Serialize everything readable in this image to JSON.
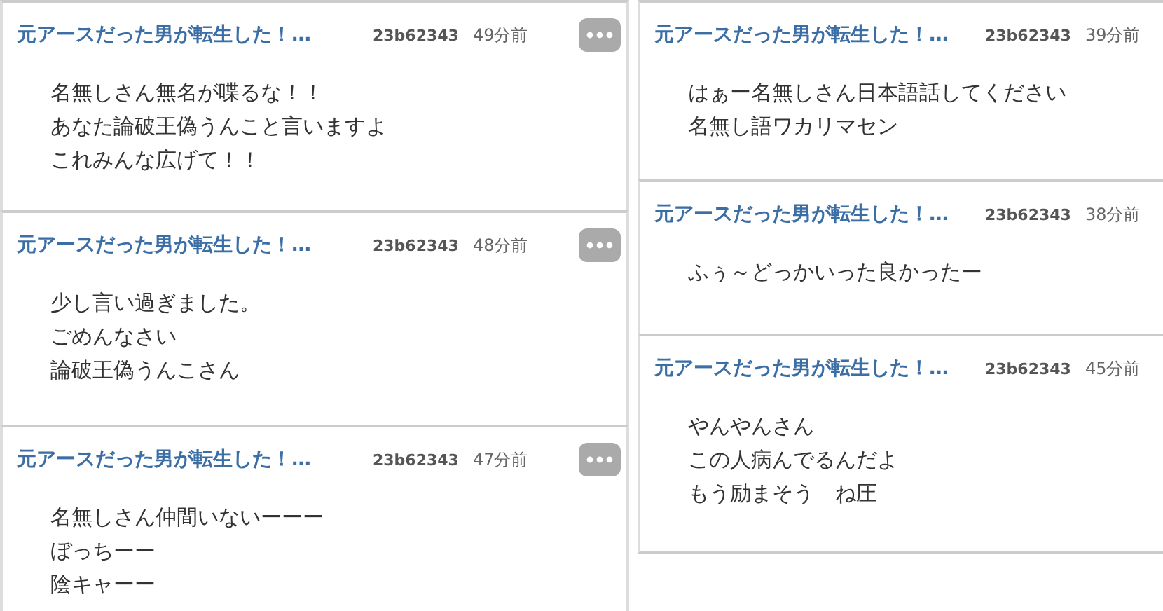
{
  "columns": [
    {
      "comments": [
        {
          "title": "元アースだった男が転生した！…",
          "user_id": "23b62343",
          "time": "49分前",
          "has_menu": true,
          "lines": [
            "名無しさん無名が喋るな！！",
            "あなた論破王偽うんこと言いますよ",
            "これみんな広げて！！"
          ]
        },
        {
          "title": "元アースだった男が転生した！…",
          "user_id": "23b62343",
          "time": "48分前",
          "has_menu": true,
          "lines": [
            "少し言い過ぎました。",
            "ごめんなさい",
            "論破王偽うんこさん"
          ]
        },
        {
          "title": "元アースだった男が転生した！…",
          "user_id": "23b62343",
          "time": "47分前",
          "has_menu": true,
          "lines": [
            "名無しさん仲間いないーーー",
            "ぼっちーー",
            "陰キャーー"
          ]
        }
      ]
    },
    {
      "comments": [
        {
          "title": "元アースだった男が転生した！…",
          "user_id": "23b62343",
          "time": "39分前",
          "has_menu": false,
          "lines": [
            "はぁー名無しさん日本語話してください",
            "名無し語ワカリマセン"
          ]
        },
        {
          "title": "元アースだった男が転生した！…",
          "user_id": "23b62343",
          "time": "38分前",
          "has_menu": false,
          "lines": [
            "ふぅ～どっかいった良かったー"
          ]
        },
        {
          "title": "元アースだった男が転生した！…",
          "user_id": "23b62343",
          "time": "45分前",
          "has_menu": false,
          "lines": [
            "やんやんさん",
            "この人病んでるんだよ",
            "もう励まそう　ね圧"
          ]
        }
      ]
    }
  ]
}
